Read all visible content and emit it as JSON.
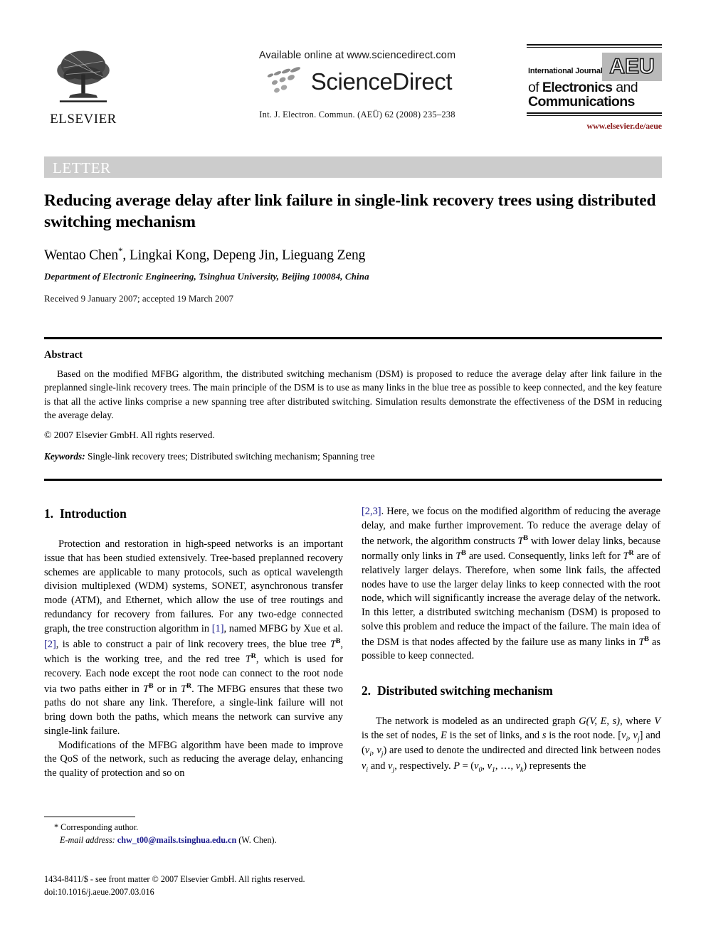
{
  "header": {
    "publisher": "ELSEVIER",
    "available_online": "Available online at www.sciencedirect.com",
    "sciencedirect_wordmark": "ScienceDirect",
    "journal_citation": "Int. J. Electron. Commun. (AEÜ) 62 (2008) 235–238",
    "journal_logo": {
      "badge": "AEU",
      "line1": "International Journal",
      "line2_thin": "of ",
      "line2_bold": "Electronics",
      "line2_tail": " and",
      "line3": "Communications",
      "url": "www.elsevier.de/aeue"
    }
  },
  "banner": {
    "label": "LETTER"
  },
  "title": "Reducing average delay after link failure in single-link recovery trees using distributed switching mechanism",
  "authors": {
    "names": "Wentao Chen",
    "star": "*",
    "rest": ", Lingkai Kong, Depeng Jin, Lieguang Zeng",
    "affiliation": "Department of Electronic Engineering, Tsinghua University, Beijing 100084, China",
    "history": "Received 9 January 2007; accepted 19 March 2007"
  },
  "abstract": {
    "heading": "Abstract",
    "body": "Based on the modified MFBG algorithm, the distributed switching mechanism (DSM) is proposed to reduce the average delay after link failure in the preplanned single-link recovery trees. The main principle of the DSM is to use as many links in the blue tree as possible to keep connected, and the key feature is that all the active links comprise a new spanning tree after distributed switching. Simulation results demonstrate the effectiveness of the DSM in reducing the average delay.",
    "copyright": "© 2007 Elsevier GmbH. All rights reserved.",
    "keywords_label": "Keywords:",
    "keywords_value": "Single-link recovery trees; Distributed switching mechanism; Spanning tree"
  },
  "sections": {
    "intro": {
      "number": "1.",
      "heading": "Introduction",
      "para1_a": "Protection and restoration in high-speed networks is an important issue that has been studied extensively. Tree-based preplanned recovery schemes are applicable to many protocols, such as optical wavelength division multiplexed (WDM) systems, SONET, asynchronous transfer mode (ATM), and Ethernet, which allow the use of tree routings and redundancy for recovery from failures. For any two-edge connected graph, the tree construction algorithm in ",
      "cite1": "[1]",
      "para1_b": ", named MFBG by Xue et al. ",
      "cite2": "[2]",
      "para1_c": ", is able to construct a pair of link recovery trees, the blue tree ",
      "tb1": "T",
      "tb1_sup": "B",
      "para1_d": ", which is the working tree, and the red tree ",
      "tr1": "T",
      "tr1_sup": "R",
      "para1_e": ", which is used for recovery. Each node except the root node can connect to the root node via two paths either in ",
      "tb2": "T",
      "tb2_sup": "B",
      "para1_f": " or in ",
      "tr2": "T",
      "tr2_sup": "R",
      "para1_g": ". The MFBG ensures that these two paths do not share any link. Therefore, a single-link failure will not bring down both the paths, which means the network can survive any single-link failure.",
      "para2": "Modifications of the MFBG algorithm have been made to improve the QoS of the network, such as reducing the average delay, enhancing the quality of protection and so on ",
      "cite3": "[2,3]",
      "para2_b": ". Here, we focus on the modified algorithm of reducing the average delay, and make further improvement. To reduce the average delay of the network, the algorithm constructs ",
      "tb3": "T",
      "tb3_sup": "B",
      "para2_c": " with lower delay links, because normally only links in ",
      "tb4": "T",
      "tb4_sup": "B",
      "para2_d": " are used. Consequently, links left for ",
      "tr3": "T",
      "tr3_sup": "R",
      "para2_e": " are of relatively larger delays. Therefore, when some link fails, the affected nodes have to use the larger delay links to keep connected with the root node, which will significantly increase the average delay of the network. In this letter, a distributed switching mechanism (DSM) is proposed to solve this problem and reduce the impact of the failure. The main idea of the DSM is that nodes affected by the failure use as many links in ",
      "tb5": "T",
      "tb5_sup": "B",
      "para2_f": " as possible to keep connected."
    },
    "dsm": {
      "number": "2.",
      "heading": "Distributed switching mechanism",
      "para1_a": "The network is modeled as an undirected graph ",
      "graph_g": "G",
      "graph_args": "(V, E, s)",
      "para1_b": ", where ",
      "var_v": "V",
      "para1_c": " is the set of nodes, ",
      "var_e": "E",
      "para1_d": " is the set of links, and ",
      "var_s": "s",
      "para1_e": " is the root node. [",
      "vi1": "v",
      "vi1_sub": "i",
      "para1_f": ", ",
      "vj1": "v",
      "vj1_sub": "j",
      "para1_g": "] and (",
      "vi2": "v",
      "vi2_sub": "i",
      "para1_h": ", ",
      "vj2": "v",
      "vj2_sub": "j",
      "para1_i": ") are used to denote the undirected and directed link between nodes ",
      "vi3": "v",
      "vi3_sub": "i",
      "para1_j": " and ",
      "vj3": "v",
      "vj3_sub": "j",
      "para1_k": ", respectively. ",
      "var_p": "P",
      "para1_l": " = (",
      "v0": "v",
      "v0_sub": "0",
      "para1_m": ", ",
      "v1": "v",
      "v1_sub": "1",
      "para1_n": ", …, ",
      "vk": "v",
      "vk_sub": "k",
      "para1_o": ") represents the"
    }
  },
  "footnote": {
    "corresponding": "* Corresponding author.",
    "email_label": "E-mail address:",
    "email_value": "chw_t00@mails.tsinghua.edu.cn",
    "email_suffix": "(W. Chen)."
  },
  "imprint": {
    "line1": "1434-8411/$ - see front matter © 2007 Elsevier GmbH. All rights reserved.",
    "line2": "doi:10.1016/j.aeue.2007.03.016"
  }
}
